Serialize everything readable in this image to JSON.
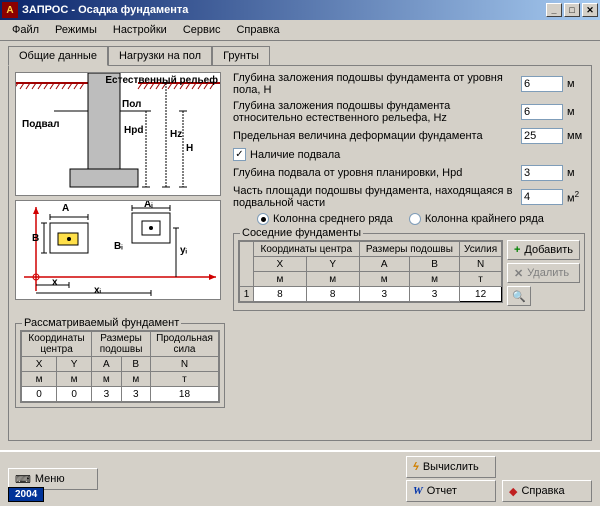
{
  "window": {
    "app": "ЗАПРОС",
    "title": "Осадка фундамента"
  },
  "menu": [
    "Файл",
    "Режимы",
    "Настройки",
    "Сервис",
    "Справка"
  ],
  "tabs": [
    "Общие данные",
    "Нагрузки на пол",
    "Грунты"
  ],
  "diagram1": {
    "relief": "Естественный\nрельеф",
    "floor": "Пол",
    "basement": "Подвал",
    "hpd": "Hpd",
    "hz": "Hz",
    "h": "H"
  },
  "diagram2": {
    "a": "A",
    "b": "B",
    "ai": "Aᵢ",
    "bi": "Bᵢ",
    "x": "x",
    "xi": "xᵢ",
    "yi": "yᵢ"
  },
  "form": {
    "depth_floor_label": "Глубина заложения подошвы фундамента от уровня пола, Н",
    "depth_floor_val": "6",
    "depth_floor_unit": "м",
    "depth_relief_label": "Глубина заложения подошвы фундамента относительно естественного рельефа, Hz",
    "depth_relief_val": "6",
    "depth_relief_unit": "м",
    "limit_label": "Предельная величина деформации фундамента",
    "limit_val": "25",
    "limit_unit": "мм",
    "has_basement_label": "Наличие подвала",
    "basement_depth_label": "Глубина подвала от уровня планировки, Hpd",
    "basement_depth_val": "3",
    "basement_depth_unit": "м",
    "basement_area_label": "Часть площади подошвы фундамента, находящаяся в подвальной части",
    "basement_area_val": "4",
    "basement_area_unit": "м",
    "radio_mid": "Колонна среднего ряда",
    "radio_edge": "Колонна крайнего ряда"
  },
  "neighbor": {
    "title": "Соседние фундаменты",
    "h_coord": "Координаты центра",
    "h_size": "Размеры подошвы",
    "h_force": "Усилия",
    "cols": {
      "x": "X",
      "y": "Y",
      "a": "A",
      "b": "B",
      "n": "N"
    },
    "units": {
      "x": "м",
      "y": "м",
      "a": "м",
      "b": "м",
      "n": "т"
    },
    "row": {
      "idx": "1",
      "x": "8",
      "y": "8",
      "a": "3",
      "b": "3",
      "n": "12"
    },
    "add": "Добавить",
    "del": "Удалить"
  },
  "main_found": {
    "title": "Рассматриваемый фундамент",
    "h_coord": "Координаты центра",
    "h_size": "Размеры подошвы",
    "h_force": "Продольная сила",
    "cols": {
      "x": "X",
      "y": "Y",
      "a": "A",
      "b": "B",
      "n": "N"
    },
    "units": {
      "x": "м",
      "y": "м",
      "a": "м",
      "b": "м",
      "n": "т"
    },
    "row": {
      "x": "0",
      "y": "0",
      "a": "3",
      "b": "3",
      "n": "18"
    }
  },
  "bottom": {
    "menu": "Меню",
    "calc": "Вычислить",
    "report": "Отчет",
    "help": "Справка",
    "year": "2004"
  }
}
